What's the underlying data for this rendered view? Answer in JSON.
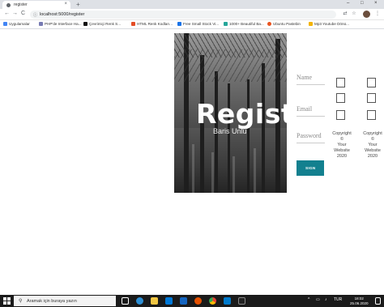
{
  "browser": {
    "tab_title": "register",
    "new_tab": "+",
    "tab_close": "×",
    "window_controls": [
      "–",
      "□",
      "×"
    ],
    "nav": {
      "back": "←",
      "forward": "→",
      "reload": "C"
    },
    "url": "localhost:5000/register",
    "url_info_icon": "ⓘ",
    "right_icons": [
      "translate-icon",
      "star-icon",
      "extension-icon",
      "menu-icon"
    ]
  },
  "bookmarks": [
    {
      "label": "Uygulamalar",
      "color": "#4285f4"
    },
    {
      "label": "PHP'de Interface Ha...",
      "color": "#777bb3"
    },
    {
      "label": "Çevrimiçi Renk S...",
      "color": "#111111"
    },
    {
      "label": "HTML Renk Kodları...",
      "color": "#e44d26"
    },
    {
      "label": "Free Small Stock Vi...",
      "color": "#1a73e8"
    },
    {
      "label": "1000+ Beautiful Ba...",
      "color": "#26a69a"
    },
    {
      "label": "Ubuntu Pastebin",
      "color": "#e95420"
    },
    {
      "label": "Mp3 Youtube Dönü...",
      "color": "#f4b400"
    }
  ],
  "page": {
    "title": "Register",
    "author": "Baris Unlu",
    "fields": {
      "name": "Name",
      "email": "Email",
      "password": "Password"
    },
    "sign_button": "SIGN",
    "copyright": [
      "Copyright",
      "©",
      "Your",
      "Website",
      "2020"
    ]
  },
  "taskbar": {
    "search_placeholder": "Aramak için buraya yazın",
    "search_icon": "⚲",
    "time": "18:02",
    "date": "25.06.2020",
    "tray": [
      "^",
      "▭",
      "♪",
      "TUR"
    ],
    "apps": [
      {
        "name": "task-view-icon",
        "color": "#ffffff"
      },
      {
        "name": "edge-icon",
        "color": "#2d8fd5"
      },
      {
        "name": "file-explorer-icon",
        "color": "#f2c744"
      },
      {
        "name": "store-icon",
        "color": "#0078d7"
      },
      {
        "name": "mail-icon",
        "color": "#1565c0"
      },
      {
        "name": "media-player-icon",
        "color": "#e65100"
      },
      {
        "name": "chrome-icon",
        "color": "#fbbc05"
      },
      {
        "name": "vscode-icon",
        "color": "#007acc"
      },
      {
        "name": "terminal-icon",
        "color": "#222222"
      }
    ]
  },
  "colors": {
    "accent": "#13808f"
  }
}
